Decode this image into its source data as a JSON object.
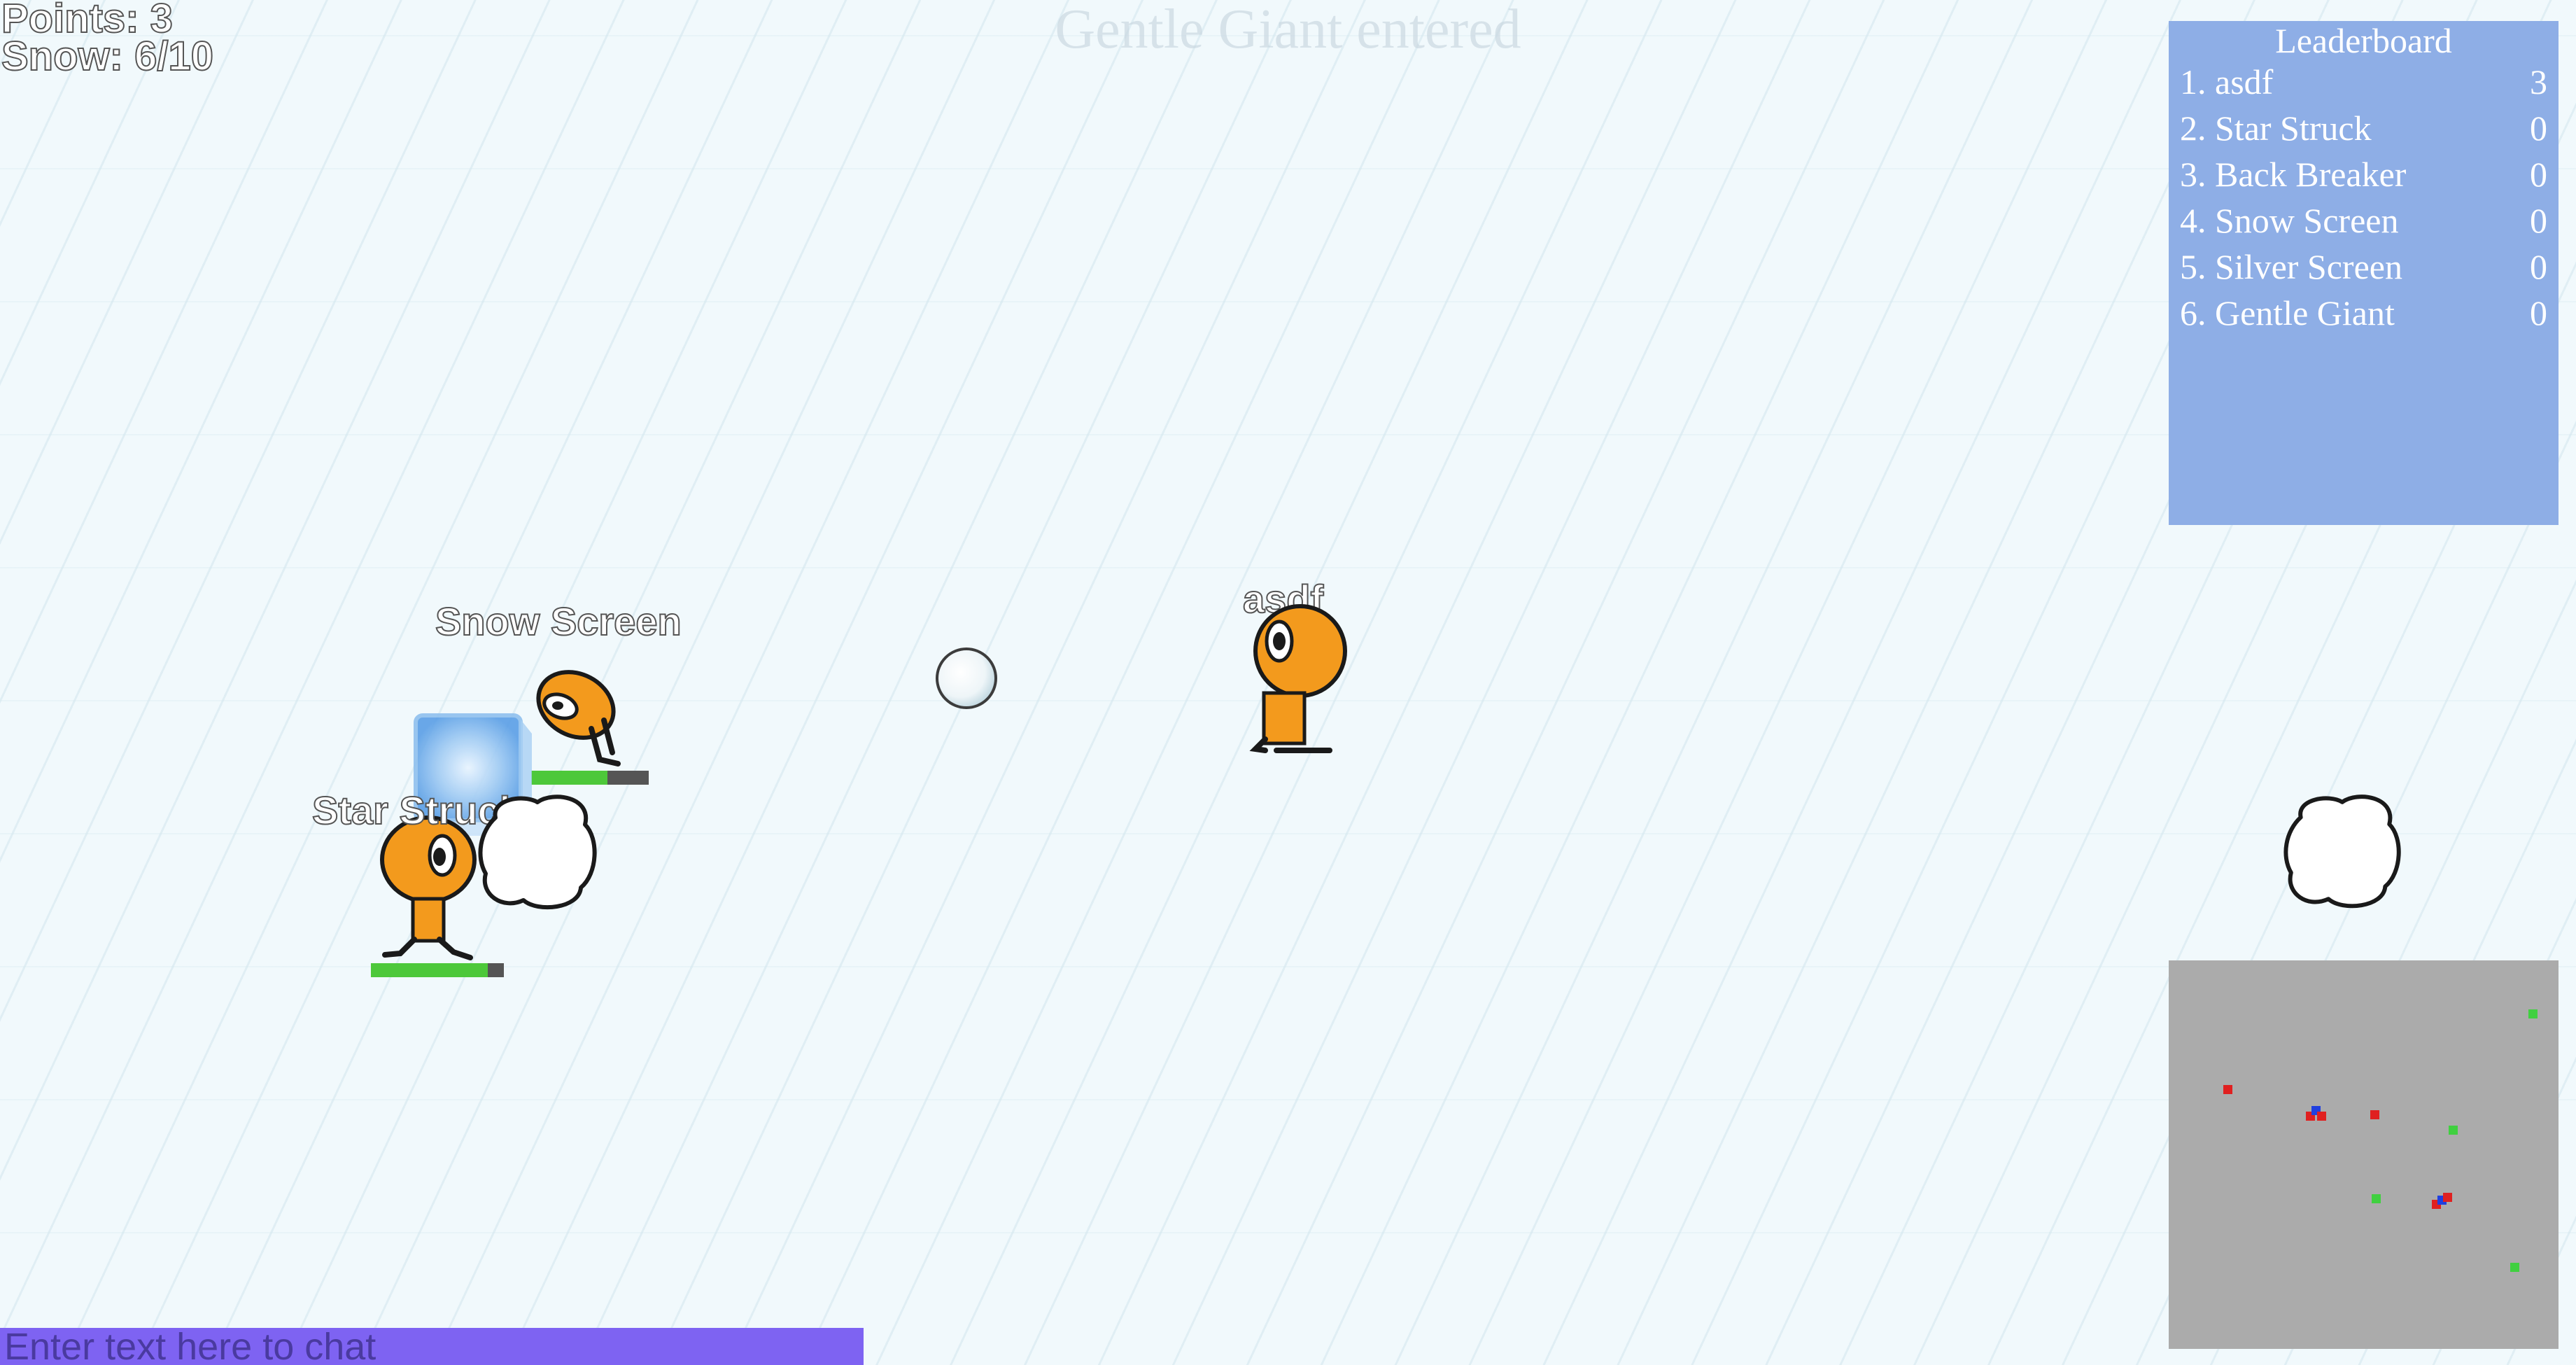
{
  "hud": {
    "points": "Points: 3",
    "snow": "Snow: 6/10"
  },
  "announcement": "Gentle Giant entered",
  "leaderboard": {
    "title": "Leaderboard",
    "entries": [
      {
        "name": "1. asdf",
        "score": "3"
      },
      {
        "name": "2. Star Struck",
        "score": "0"
      },
      {
        "name": "3. Back Breaker",
        "score": "0"
      },
      {
        "name": "4. Snow Screen",
        "score": "0"
      },
      {
        "name": "5. Silver Screen",
        "score": "0"
      },
      {
        "name": "6. Gentle Giant",
        "score": "0"
      }
    ],
    "background": "#8eaee6"
  },
  "players": {
    "snow_screen": {
      "name": "Snow Screen",
      "health": 0.65
    },
    "star_struck": {
      "name": "Star Struck",
      "health": 0.88
    },
    "asdf": {
      "name": "asdf"
    }
  },
  "colors": {
    "player_body": "#f39a1d",
    "health_fill": "#4dc83a",
    "health_empty": "#555555",
    "minimap_bg": "#ababab",
    "chat_bg": "#7e63f2"
  },
  "chat": {
    "placeholder": "Enter text here to chat"
  }
}
